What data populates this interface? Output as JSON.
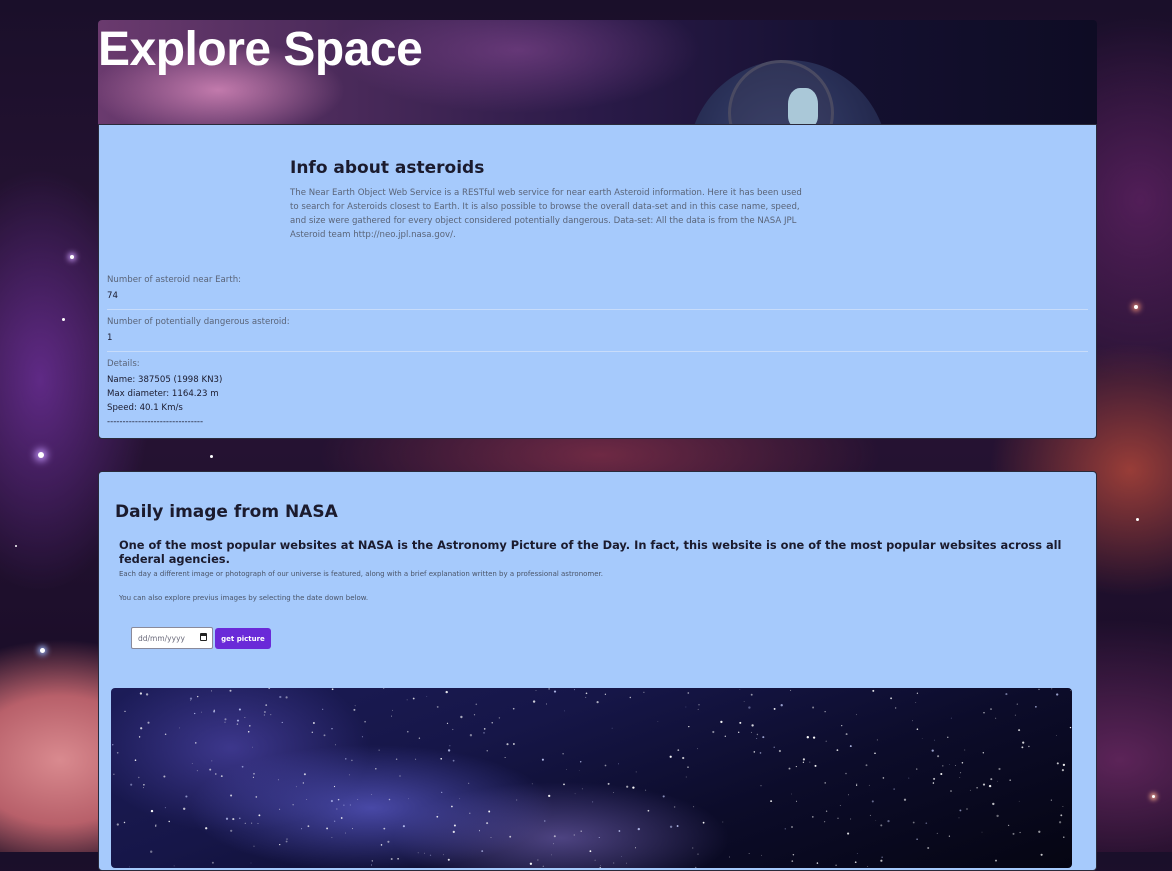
{
  "header": {
    "title": "Explore Space"
  },
  "asteroids": {
    "title": "Info about asteroids",
    "description": "The Near Earth Object Web Service is a RESTful web service for near earth Asteroid information. Here it has been used to search for Asteroids closest to Earth. It is also possible to browse the overall data-set and in this case name, speed, and size were gathered for every object considered potentially dangerous. Data-set: All the data is from the NASA JPL Asteroid team http://neo.jpl.nasa.gov/.",
    "near_earth_label": "Number of asteroid near Earth:",
    "near_earth_value": "74",
    "dangerous_label": "Number of potentially dangerous asteroid:",
    "dangerous_value": "1",
    "details_label": "Details:",
    "details": {
      "name": "Name: 387505 (1998 KN3)",
      "diameter": "Max diameter: 1164.23 m",
      "speed": "Speed: 40.1 Km/s",
      "separator": "-------------------------------"
    }
  },
  "nasa": {
    "title": "Daily image from NASA",
    "lead": "One of the most popular websites at NASA is the Astronomy Picture of the Day. In fact, this website is one of the most popular websites across all federal agencies.",
    "paragraph1": "Each day a different image or photograph of our universe is featured, along with a brief explanation written by a professional astronomer.",
    "paragraph2": "You can also explore previus images by selecting the date down below.",
    "date_placeholder": "dd/mm/yyyy",
    "button_label": "get picture"
  }
}
